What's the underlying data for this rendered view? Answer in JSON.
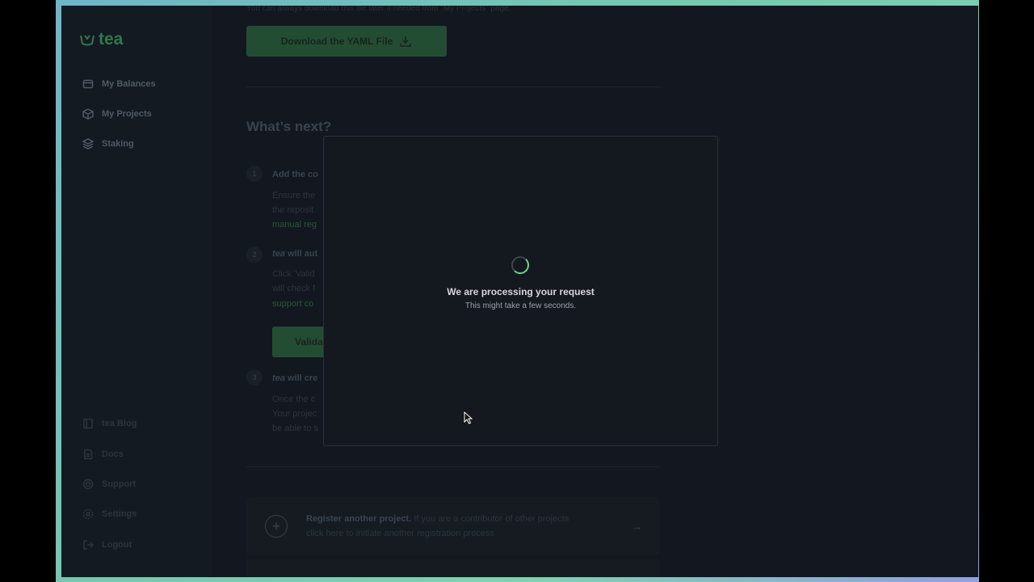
{
  "sidebar": {
    "logo_text": "tea",
    "items": [
      {
        "label": "My Balances",
        "icon": "wallet-icon"
      },
      {
        "label": "My Projects",
        "icon": "box-icon"
      },
      {
        "label": "Staking",
        "icon": "layers-icon"
      }
    ],
    "bottom_items": [
      {
        "label": "tea Blog",
        "icon": "book-icon"
      },
      {
        "label": "Docs",
        "icon": "doc-icon"
      },
      {
        "label": "Support",
        "icon": "lifebuoy-icon"
      },
      {
        "label": "Settings",
        "icon": "gear-icon"
      },
      {
        "label": "Logout",
        "icon": "logout-icon"
      }
    ]
  },
  "main": {
    "top_note": "You can always download this file later if needed from \"My Projects\" page.",
    "download_button": "Download the YAML File",
    "whats_next": "What’s next?",
    "steps": [
      {
        "num": "1",
        "title": "Add the co",
        "text_lines": [
          "Ensure the",
          "the reposit"
        ],
        "link": "manual reg"
      },
      {
        "num": "2",
        "title_em": "tea",
        "title": " will aut",
        "text_lines": [
          "Click 'Valid",
          "will check f"
        ],
        "link": "support co"
      },
      {
        "num": "3",
        "title_em": "tea",
        "title": " will cre",
        "text_lines": [
          "Once the c",
          "Your projec",
          "be able to s"
        ]
      }
    ],
    "validate_button": "Valida",
    "register": {
      "bold": "Register another project.",
      "text": " If you are a contributor of other projects click here to initiate another registration process"
    }
  },
  "modal": {
    "title": "We are processing your request",
    "subtitle": "This might take a few seconds."
  },
  "colors": {
    "accent": "#6fd28a",
    "background": "#13171f"
  }
}
